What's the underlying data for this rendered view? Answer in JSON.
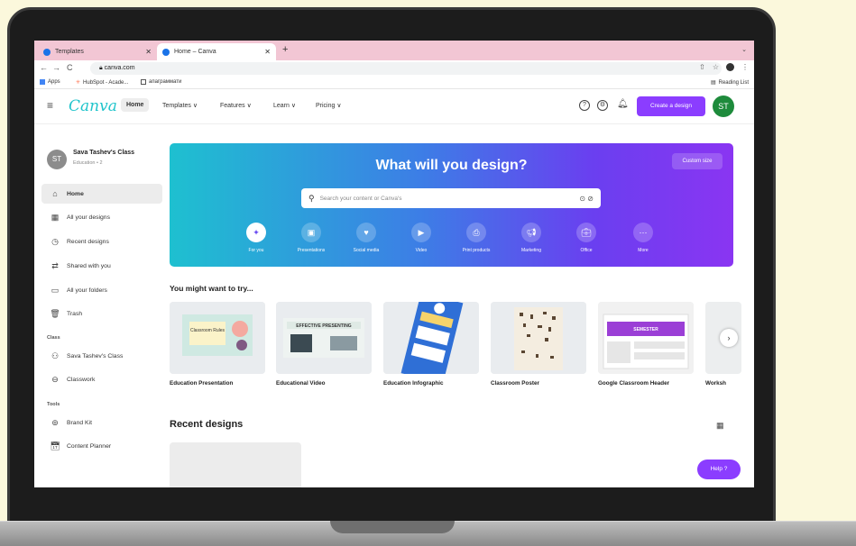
{
  "browser": {
    "tabs": [
      {
        "label": "Templates"
      },
      {
        "label": "Home – Canva"
      }
    ],
    "url": "canva.com",
    "bookmarks": [
      "Apps",
      "HubSpot - Acade...",
      "апаграммати"
    ],
    "reading_list": "Reading List"
  },
  "header": {
    "logo": "Canva",
    "nav": [
      "Home",
      "Templates ∨",
      "Features ∨",
      "Learn ∨",
      "Pricing ∨"
    ],
    "create_button": "Create a design",
    "avatar": "ST"
  },
  "sidebar": {
    "team_avatar": "ST",
    "team_name": "Sava Tashev's Class",
    "team_sub": "Education • 2",
    "items": [
      {
        "label": "Home",
        "icon": "home-icon"
      },
      {
        "label": "All your designs",
        "icon": "grid-icon"
      },
      {
        "label": "Recent designs",
        "icon": "clock-icon"
      },
      {
        "label": "Shared with you",
        "icon": "shared-icon"
      },
      {
        "label": "All your folders",
        "icon": "folder-icon"
      },
      {
        "label": "Trash",
        "icon": "trash-icon"
      }
    ],
    "class_section": "Class",
    "class_items": [
      {
        "label": "Sava Tashev's Class",
        "icon": "people-icon"
      },
      {
        "label": "Classwork",
        "icon": "classwork-icon"
      }
    ],
    "tools_section": "Tools",
    "tools_items": [
      {
        "label": "Brand Kit",
        "icon": "brand-kit-icon"
      },
      {
        "label": "Content Planner",
        "icon": "calendar-icon"
      }
    ]
  },
  "hero": {
    "title": "What will you design?",
    "custom_size": "Custom size",
    "search_placeholder": "Search your content or Canva's",
    "categories": [
      {
        "label": "For you"
      },
      {
        "label": "Presentations"
      },
      {
        "label": "Social media"
      },
      {
        "label": "Video"
      },
      {
        "label": "Print products"
      },
      {
        "label": "Marketing"
      },
      {
        "label": "Office"
      },
      {
        "label": "More"
      }
    ]
  },
  "suggestions": {
    "title": "You might want to try...",
    "cards": [
      {
        "label": "Education Presentation"
      },
      {
        "label": "Educational Video"
      },
      {
        "label": "Education Infographic"
      },
      {
        "label": "Classroom Poster"
      },
      {
        "label": "Google Classroom Header"
      },
      {
        "label": "Worksh"
      }
    ],
    "thumb_text": {
      "presentation": "Classroom Rules",
      "video": "EFFECTIVE PRESENTING",
      "header": "SEMESTER"
    }
  },
  "recent": {
    "title": "Recent designs"
  },
  "help": "Help ?",
  "colors": {
    "brand_purple": "#8b3dff",
    "logo_teal": "#20c4cb",
    "avatar_green": "#1e8b3c"
  }
}
